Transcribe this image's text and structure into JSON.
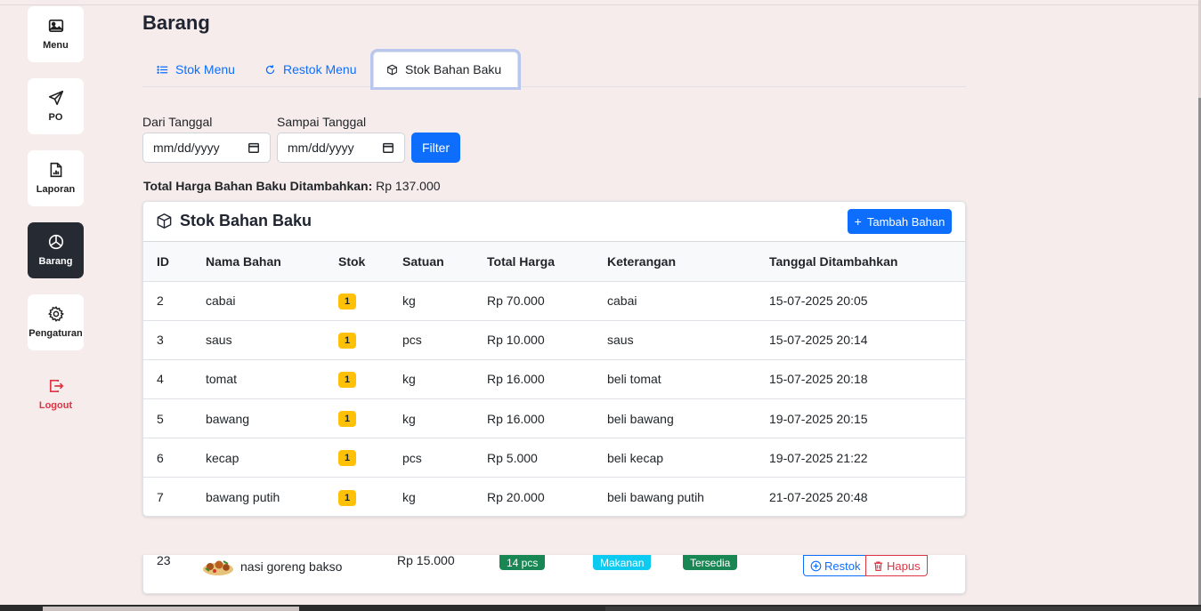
{
  "sidebar": {
    "items": [
      {
        "label": "Menu",
        "icon": "image-icon"
      },
      {
        "label": "PO",
        "icon": "send-icon"
      },
      {
        "label": "Laporan",
        "icon": "report-icon"
      },
      {
        "label": "Barang",
        "icon": "pie-chart-icon",
        "active": true
      },
      {
        "label": "Pengaturan",
        "icon": "gear-icon"
      }
    ],
    "logout": "Logout"
  },
  "page": {
    "title": "Barang"
  },
  "tabs": [
    {
      "label": "Stok Menu",
      "icon": "list-icon"
    },
    {
      "label": "Restok Menu",
      "icon": "refresh-icon"
    },
    {
      "label": "Stok Bahan Baku",
      "icon": "box-icon",
      "active": true
    }
  ],
  "filter": {
    "from_label": "Dari Tanggal",
    "to_label": "Sampai Tanggal",
    "from_value": "mm/dd/yyyy",
    "to_value": "mm/dd/yyyy",
    "button": "Filter"
  },
  "summary": {
    "label": "Total Harga Bahan Baku Ditambahkan:",
    "value": "Rp 137.000"
  },
  "card": {
    "title": "Stok Bahan Baku",
    "add_button": "Tambah Bahan",
    "columns": [
      "ID",
      "Nama Bahan",
      "Stok",
      "Satuan",
      "Total Harga",
      "Keterangan",
      "Tanggal Ditambahkan"
    ],
    "rows": [
      {
        "id": "2",
        "nama": "cabai",
        "stok": "1",
        "satuan": "kg",
        "harga": "Rp 70.000",
        "ket": "cabai",
        "tanggal": "15-07-2025 20:05"
      },
      {
        "id": "3",
        "nama": "saus",
        "stok": "1",
        "satuan": "pcs",
        "harga": "Rp 10.000",
        "ket": "saus",
        "tanggal": "15-07-2025 20:14"
      },
      {
        "id": "4",
        "nama": "tomat",
        "stok": "1",
        "satuan": "kg",
        "harga": "Rp 16.000",
        "ket": "beli tomat",
        "tanggal": "15-07-2025 20:18"
      },
      {
        "id": "5",
        "nama": "bawang",
        "stok": "1",
        "satuan": "kg",
        "harga": "Rp 16.000",
        "ket": "beli bawang",
        "tanggal": "19-07-2025 20:15"
      },
      {
        "id": "6",
        "nama": "kecap",
        "stok": "1",
        "satuan": "pcs",
        "harga": "Rp 5.000",
        "ket": "beli kecap",
        "tanggal": "19-07-2025 21:22"
      },
      {
        "id": "7",
        "nama": "bawang putih",
        "stok": "1",
        "satuan": "kg",
        "harga": "Rp 20.000",
        "ket": "beli bawang putih",
        "tanggal": "21-07-2025 20:48"
      }
    ]
  },
  "behind_row": {
    "id": "23",
    "nama": "nasi goreng bakso",
    "harga": "Rp 15.000",
    "stok": "14 pcs",
    "kategori": "Makanan",
    "status": "Tersedia",
    "restok": "Restok",
    "hapus": "Hapus"
  },
  "colors": {
    "primary": "#0d6efd",
    "sidebar_active": "#262a33",
    "warning": "#ffc107",
    "danger": "#dc3545",
    "success": "#198754",
    "info": "#0dcaf0",
    "background": "#f6eceb"
  }
}
